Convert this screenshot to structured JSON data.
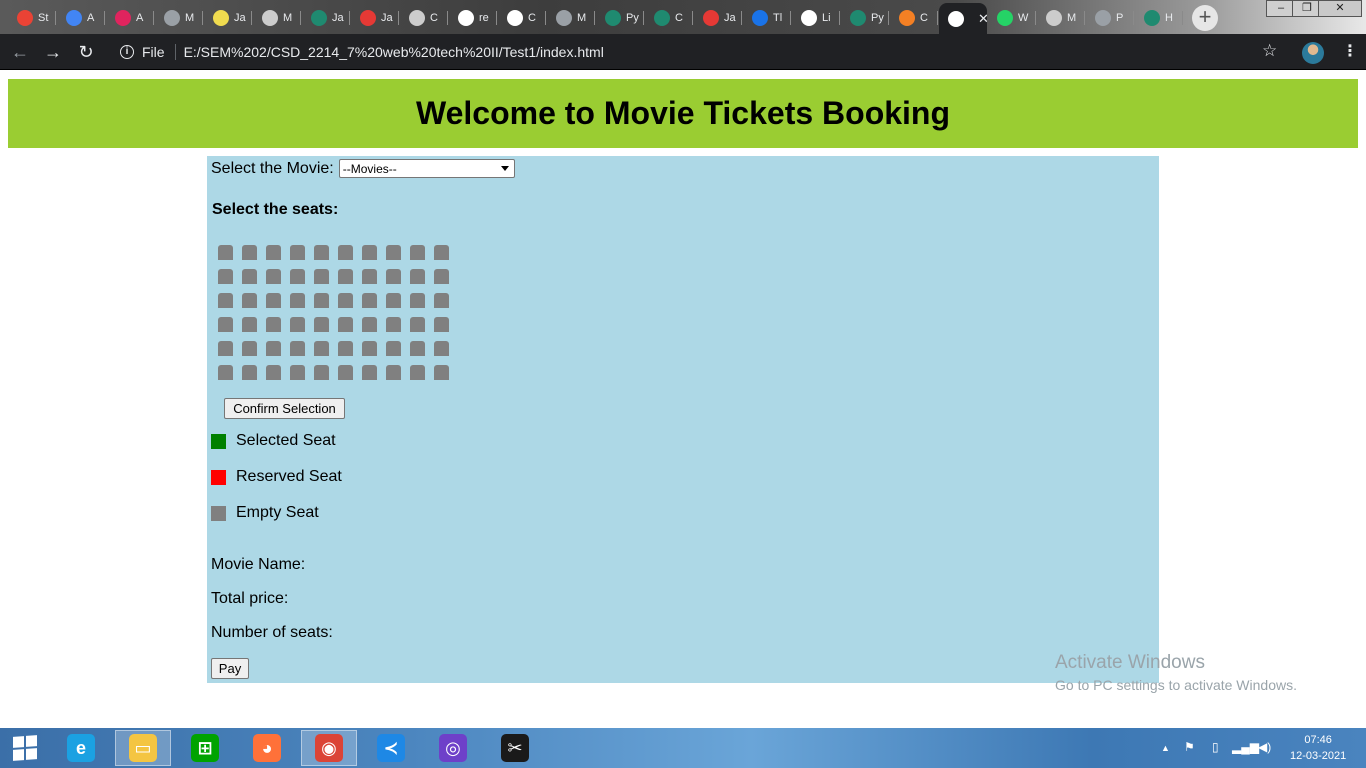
{
  "browser": {
    "tabs": [
      {
        "icon": "gmail-icon",
        "label": "St",
        "color": "#ea4335"
      },
      {
        "icon": "plus-circle-icon",
        "label": "A",
        "color": "#4285f4"
      },
      {
        "icon": "m-logo-icon",
        "label": "A",
        "color": "#e0245e"
      },
      {
        "icon": "globe-icon",
        "label": "M",
        "color": "#9aa0a6"
      },
      {
        "icon": "js-icon",
        "label": "Ja",
        "color": "#f0db4f"
      },
      {
        "icon": "codepen-icon",
        "label": "M",
        "color": "#cccccc"
      },
      {
        "icon": "w-logo-icon",
        "label": "Ja",
        "color": "#1f8a70"
      },
      {
        "icon": "triangle-logo-icon",
        "label": "Ja",
        "color": "#e53935"
      },
      {
        "icon": "codepen-icon",
        "label": "C",
        "color": "#cccccc"
      },
      {
        "icon": "github-icon",
        "label": "re",
        "color": "#ffffff"
      },
      {
        "icon": "github-icon",
        "label": "C",
        "color": "#ffffff"
      },
      {
        "icon": "globe-icon",
        "label": "M",
        "color": "#9aa0a6"
      },
      {
        "icon": "w-logo-icon",
        "label": "Py",
        "color": "#1f8a70"
      },
      {
        "icon": "w-logo-icon",
        "label": "C",
        "color": "#1f8a70"
      },
      {
        "icon": "triangle-logo-icon",
        "label": "Ja",
        "color": "#e53935"
      },
      {
        "icon": "play-icon",
        "label": "Tl",
        "color": "#1a73e8"
      },
      {
        "icon": "github-icon",
        "label": "Li",
        "color": "#ffffff"
      },
      {
        "icon": "w-logo-icon",
        "label": "Py",
        "color": "#1f8a70"
      },
      {
        "icon": "stack-icon",
        "label": "C",
        "color": "#f48024"
      },
      {
        "icon": "globe-icon",
        "label": "",
        "color": "#ffffff",
        "active": true
      },
      {
        "icon": "whatsapp-icon",
        "label": "W",
        "color": "#25d366"
      },
      {
        "icon": "codepen-icon",
        "label": "M",
        "color": "#cccccc"
      },
      {
        "icon": "globe-icon",
        "label": "P",
        "color": "#9aa0a6"
      },
      {
        "icon": "w-logo-icon",
        "label": "H",
        "color": "#1f8a70"
      }
    ],
    "new_tab": "+",
    "window_controls": {
      "minimize": "–",
      "restore": "❐",
      "close": "✕"
    },
    "address": {
      "scheme_label": "File",
      "url": "E:/SEM%202/CSD_2214_7%20web%20tech%20II/Test1/index.html"
    }
  },
  "page": {
    "heading": "Welcome to Movie Tickets Booking",
    "movie_label": "Select the Movie:",
    "movie_select_value": "--Movies--",
    "seats_title": "Select the seats:",
    "seat_grid": {
      "rows": 6,
      "cols": 10
    },
    "confirm_button": "Confirm Selection",
    "legend": [
      {
        "label": "Selected Seat",
        "color": "#008000"
      },
      {
        "label": "Reserved Seat",
        "color": "#ff0000"
      },
      {
        "label": "Empty Seat",
        "color": "#808080"
      }
    ],
    "movie_name_label": "Movie Name:",
    "total_price_label": "Total price:",
    "num_seats_label": "Number of seats:",
    "pay_button": "Pay"
  },
  "watermark": {
    "title": "Activate Windows",
    "subtitle": "Go to PC settings to activate Windows."
  },
  "taskbar": {
    "apps": [
      {
        "name": "internet-explorer-icon",
        "glyph": "e",
        "color": "#1ba1e2"
      },
      {
        "name": "file-explorer-icon",
        "glyph": "▭",
        "color": "#f4c542",
        "active": true
      },
      {
        "name": "store-icon",
        "glyph": "⊞",
        "color": "#00a300"
      },
      {
        "name": "firefox-icon",
        "glyph": "◕",
        "color": "#ff7139"
      },
      {
        "name": "chrome-icon",
        "glyph": "◉",
        "color": "#db4437",
        "active": true
      },
      {
        "name": "vscode-icon",
        "glyph": "≺",
        "color": "#1e88e5"
      },
      {
        "name": "github-desktop-icon",
        "glyph": "◎",
        "color": "#6e40c9"
      },
      {
        "name": "scissors-app-icon",
        "glyph": "✂",
        "color": "#1a1a1a"
      }
    ],
    "time": "07:46",
    "date": "12-03-2021"
  }
}
